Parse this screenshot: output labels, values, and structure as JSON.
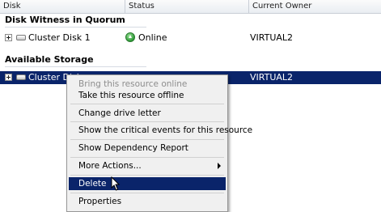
{
  "columns": {
    "disk": "Disk",
    "status": "Status",
    "owner": "Current Owner"
  },
  "groups": {
    "witness": "Disk Witness in Quorum",
    "storage": "Available Storage"
  },
  "rows": [
    {
      "disk": "Cluster Disk 1",
      "status": "Online",
      "owner": "VIRTUAL2"
    },
    {
      "disk": "Cluster Disk",
      "status": "",
      "owner": "VIRTUAL2"
    }
  ],
  "context_menu": {
    "items": [
      {
        "label": "Bring this resource online",
        "enabled": false
      },
      {
        "label": "Take this resource offline",
        "enabled": true
      },
      {
        "label": "Change drive letter",
        "enabled": true
      },
      {
        "label": "Show the critical events for this resource",
        "enabled": true
      },
      {
        "label": "Show Dependency Report",
        "enabled": true
      },
      {
        "label": "More Actions...",
        "enabled": true,
        "submenu": true
      },
      {
        "label": "Delete",
        "enabled": true,
        "highlighted": true
      },
      {
        "label": "Properties",
        "enabled": true
      }
    ]
  },
  "colors": {
    "selection": "#0a246a",
    "online": "#2c9a36"
  }
}
